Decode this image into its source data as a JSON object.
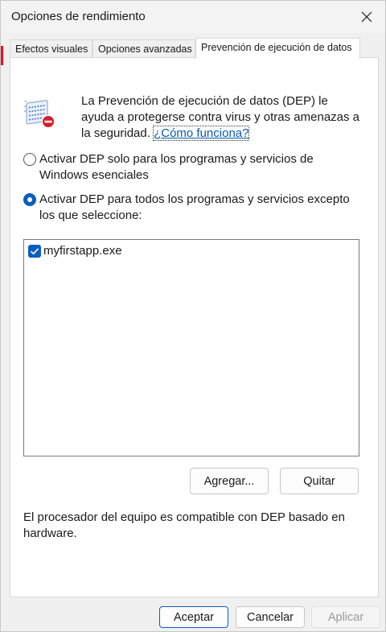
{
  "window": {
    "title": "Opciones de rendimiento"
  },
  "tabs": [
    {
      "label": "Efectos visuales"
    },
    {
      "label": "Opciones avanzadas"
    },
    {
      "label": "Prevención de ejecución de datos",
      "active": true
    }
  ],
  "intro": {
    "text": "La Prevención de ejecución de datos (DEP) le ayuda a protegerse contra virus y otras amenazas a la seguridad.",
    "link": "¿Cómo funciona?"
  },
  "options": [
    {
      "label": "Activar DEP solo para los programas y servicios de Windows esenciales",
      "selected": false
    },
    {
      "label": "Activar DEP para todos los programas y servicios excepto los que seleccione:",
      "selected": true
    }
  ],
  "exceptions": [
    {
      "name": "myfirstapp.exe",
      "checked": true
    }
  ],
  "buttons": {
    "add": "Agregar...",
    "remove": "Quitar",
    "ok": "Aceptar",
    "cancel": "Cancelar",
    "apply": "Aplicar"
  },
  "hardware_note": "El procesador del equipo es compatible con DEP basado en hardware.",
  "colors": {
    "accent": "#0a5dc2"
  }
}
